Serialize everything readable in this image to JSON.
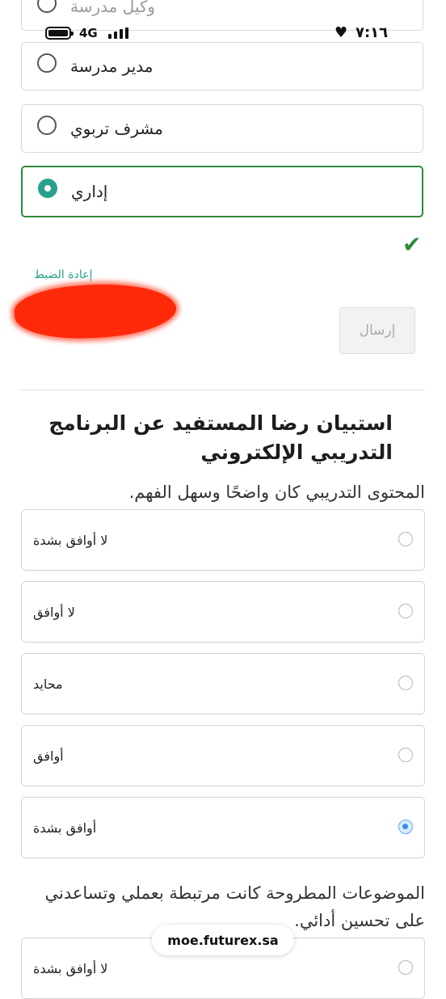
{
  "status_bar": {
    "network": "4G",
    "time": "٧:١٦"
  },
  "role_question": {
    "options": [
      {
        "label": "وكيل مدرسة",
        "selected": false
      },
      {
        "label": "مدير مدرسة",
        "selected": false
      },
      {
        "label": "مشرف تربوي",
        "selected": false
      },
      {
        "label": "إداري",
        "selected": true
      }
    ]
  },
  "form_actions": {
    "reset_label": "إعادة الضبط",
    "submit_label": "إرسال"
  },
  "survey": {
    "title": "استبيان رضا المستفيد عن البرنامج التدريبي الإلكتروني",
    "question1": {
      "text": "المحتوى التدريبي كان واضحًا وسهل الفهم.",
      "options": [
        {
          "label": "لا أوافق بشدة",
          "selected": false
        },
        {
          "label": "لا أوافق",
          "selected": false
        },
        {
          "label": "محايد",
          "selected": false
        },
        {
          "label": "أوافق",
          "selected": false
        },
        {
          "label": "أوافق بشدة",
          "selected": true
        }
      ]
    },
    "question2": {
      "text": "الموضوعات المطروحة كانت مرتبطة بعملي وتساعدني على تحسين أدائي.",
      "first_option": "لا أوافق بشدة"
    }
  },
  "browser": {
    "url": "moe.futurex.sa"
  },
  "colors": {
    "accent": "#2aa18d",
    "selected_border": "#2e8b3a",
    "radio_on": "#3b8fe6"
  }
}
